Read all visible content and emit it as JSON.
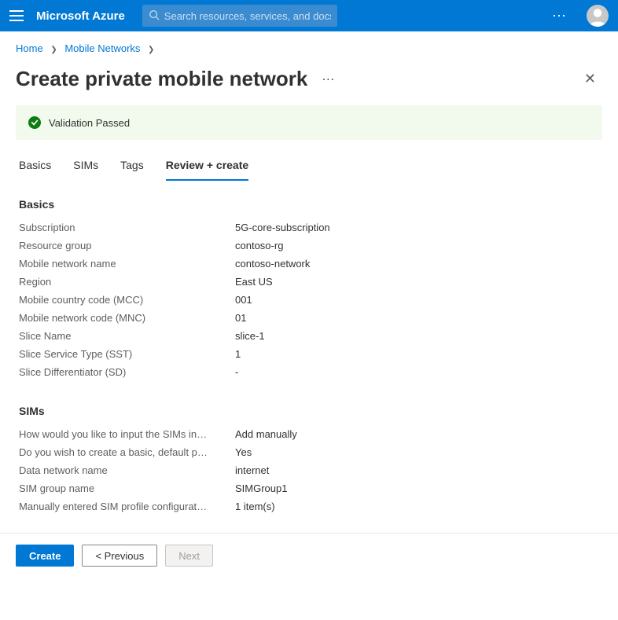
{
  "header": {
    "brand": "Microsoft Azure",
    "search_placeholder": "Search resources, services, and docs (G+/)"
  },
  "breadcrumb": {
    "items": [
      "Home",
      "Mobile Networks"
    ]
  },
  "page": {
    "title": "Create private mobile network",
    "validation_text": "Validation Passed"
  },
  "tabs": {
    "items": [
      "Basics",
      "SIMs",
      "Tags",
      "Review + create"
    ],
    "active_index": 3
  },
  "sections": {
    "basics": {
      "title": "Basics",
      "rows": [
        {
          "key": "Subscription",
          "val": "5G-core-subscription"
        },
        {
          "key": "Resource group",
          "val": "contoso-rg"
        },
        {
          "key": "Mobile network name",
          "val": "contoso-network"
        },
        {
          "key": "Region",
          "val": "East US"
        },
        {
          "key": "Mobile country code (MCC)",
          "val": "001"
        },
        {
          "key": "Mobile network code (MNC)",
          "val": "01"
        },
        {
          "key": "Slice Name",
          "val": "slice-1"
        },
        {
          "key": "Slice Service Type (SST)",
          "val": "1"
        },
        {
          "key": "Slice Differentiator (SD)",
          "val": "-"
        }
      ]
    },
    "sims": {
      "title": "SIMs",
      "rows": [
        {
          "key": "How would you like to input the SIMs in…",
          "val": "Add manually"
        },
        {
          "key": "Do you wish to create a basic, default p…",
          "val": "Yes"
        },
        {
          "key": "Data network name",
          "val": "internet"
        },
        {
          "key": "SIM group name",
          "val": "SIMGroup1"
        },
        {
          "key": "Manually entered SIM profile configurat…",
          "val": "1 item(s)"
        }
      ]
    }
  },
  "footer": {
    "create": "Create",
    "previous": "< Previous",
    "next": "Next"
  }
}
